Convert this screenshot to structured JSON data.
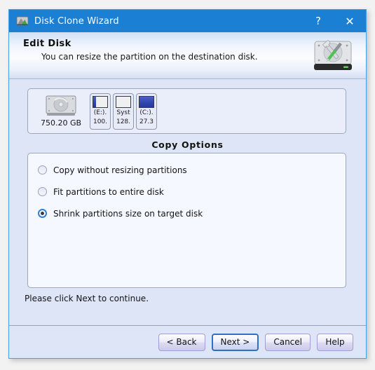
{
  "window": {
    "title": "Disk Clone Wizard",
    "title_icon": "disk-clone-icon",
    "help_button": "?",
    "close_button": "✕",
    "accent_color": "#1b7fd4",
    "body_color": "#dde5f6"
  },
  "header": {
    "title": "Edit Disk",
    "subtitle": "You can resize the partition on the destination disk.",
    "icon": "disk-with-tools-icon"
  },
  "disk_panel": {
    "disk": {
      "icon": "hard-disk-icon",
      "capacity": "750.20 GB"
    },
    "partitions": [
      {
        "label_line1": "(E:).",
        "label_line2": "100.",
        "fill_percent": 22,
        "fill_color": "#2f46ae"
      },
      {
        "label_line1": "Syst",
        "label_line2": "128.",
        "fill_percent": 0,
        "fill_color": "#2f46ae"
      },
      {
        "label_line1": "(C:).",
        "label_line2": "27.3",
        "fill_percent": 100,
        "fill_color": "#2f46ae"
      }
    ]
  },
  "copy_options": {
    "title": "Copy Options",
    "options": [
      {
        "label": "Copy without resizing partitions",
        "selected": false
      },
      {
        "label": "Fit partitions to entire disk",
        "selected": false
      },
      {
        "label": "Shrink partitions size on target disk",
        "selected": true
      }
    ]
  },
  "hint": "Please click Next to continue.",
  "footer": {
    "buttons": [
      {
        "label": "< Back",
        "default": false
      },
      {
        "label": "Next >",
        "default": true
      },
      {
        "label": "Cancel",
        "default": false
      },
      {
        "label": "Help",
        "default": false
      }
    ]
  }
}
